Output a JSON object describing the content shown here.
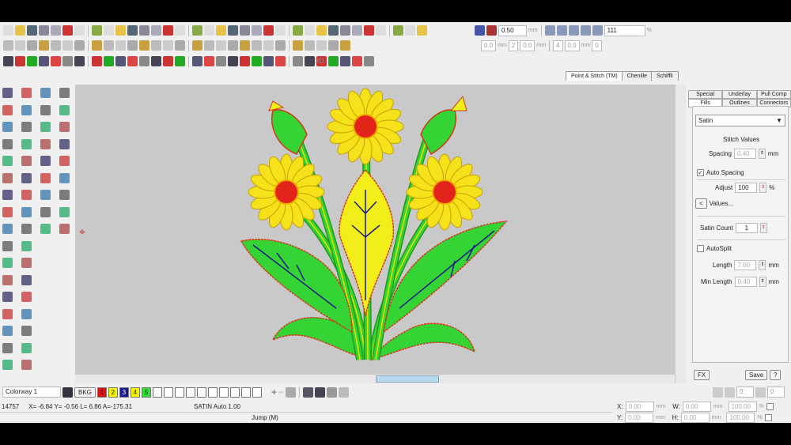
{
  "toolbar": {
    "stitch_length": "0.50",
    "stitch_unit": "mm",
    "zoom": "111",
    "zoom_unit": "%",
    "row2": {
      "v1": "0.0",
      "u1": "mm",
      "count": "2",
      "v2": "0.0",
      "u2": "mm",
      "v3": "4",
      "v4": "0.0",
      "u4": "mm",
      "v5": "0"
    },
    "label_3d": "3D"
  },
  "mode_tabs": [
    "Point & Stitch (TM)",
    "Chenille",
    "Schiffli"
  ],
  "panel": {
    "tabs_top": [
      "Special",
      "Underlay",
      "Pull Comp"
    ],
    "tabs_bottom": [
      "Fills",
      "Outlines",
      "Connectors"
    ],
    "fill_type": "Satin",
    "stitch_values": "Stitch Values",
    "spacing_label": "Spacing",
    "spacing": "0.40",
    "mm": "mm",
    "auto_spacing": "Auto Spacing",
    "adjust_label": "Adjust",
    "adjust": "100",
    "percent": "%",
    "values_btn_icon": "<",
    "values_label": "Values...",
    "satin_count_label": "Satin Count",
    "satin_count": "1",
    "autosplit": "AutoSplit",
    "length_label": "Length",
    "length": "7.00",
    "min_length_label": "Min Length",
    "min_length": "0.40",
    "fx": "FX",
    "save": "Save",
    "help": "?"
  },
  "colorbar": {
    "colorway": "Colorway 1",
    "bkg": "BKG",
    "colors": [
      {
        "n": "1",
        "c": "#e01010"
      },
      {
        "n": "2",
        "c": "#f5f500"
      },
      {
        "n": "3",
        "c": "#1a1a8a"
      },
      {
        "n": "4",
        "c": "#f5f500"
      },
      {
        "n": "5",
        "c": "#33dd33"
      }
    ],
    "rot1": "0",
    "rot2": "0"
  },
  "status": {
    "count": "14757",
    "coords": "X= -6.84 Y= -0.56 L= 6.86 A=-175.31",
    "mode": "SATIN Auto 1.00",
    "next": "Jump (M)",
    "x_label": "X:",
    "x": "0.00",
    "y_label": "Y:",
    "y": "0.00",
    "w_label": "W:",
    "w": "0.00",
    "h_label": "H:",
    "h": "0.00",
    "mm": "mm",
    "sx": "100.00",
    "sy": "100.00",
    "pct": "%"
  }
}
